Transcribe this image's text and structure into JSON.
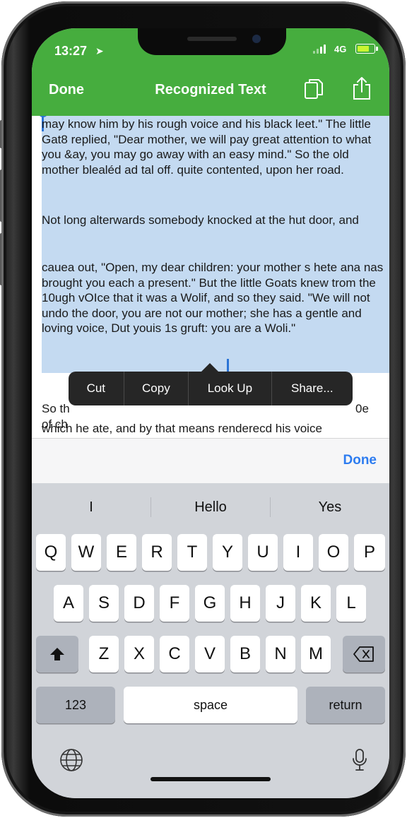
{
  "status": {
    "time": "13:27",
    "network": "4G"
  },
  "nav": {
    "done": "Done",
    "title": "Recognized Text"
  },
  "text": {
    "p1": "may know him by his rough voice and his black leet.\" The little Gat8 replied, \"Dear mother, we will pay great attention to what you &ay, you may go away with an easy mind.\" So the old mother blealéd ad tal off. quite contented, upon her road.",
    "p2": "Not long alterwards somebody knocked at the hut door, and",
    "p3": "cauea out, \"Open, my dear children: your mother s hete ana nas brought you each a present.\" But the little Goats knew trom the 10ugh vOIce that it was a Wolif, and so they said. \"We will not undo the door, you are not our mother; she has a gentle and loving voice, Dut youis 1s gruft: you are a Woli.\"",
    "p4_left": "So th",
    "p4_right": "0e",
    "p4_line2": "of ch",
    "p5": "which he ate, and by that means renderecd his voice"
  },
  "context_menu": [
    "Cut",
    "Copy",
    "Look Up",
    "Share..."
  ],
  "accessory": {
    "done": "Done"
  },
  "keyboard": {
    "suggestions": [
      "I",
      "Hello",
      "Yes"
    ],
    "row1": [
      "Q",
      "W",
      "E",
      "R",
      "T",
      "Y",
      "U",
      "I",
      "O",
      "P"
    ],
    "row2": [
      "A",
      "S",
      "D",
      "F",
      "G",
      "H",
      "J",
      "K",
      "L"
    ],
    "row3": [
      "Z",
      "X",
      "C",
      "V",
      "B",
      "N",
      "M"
    ],
    "numbers": "123",
    "space": "space",
    "return": "return"
  },
  "colors": {
    "header": "#46ad3e",
    "selection": "#c4daf1",
    "accent": "#2d7cf0"
  },
  "icons": [
    "location-arrow-icon",
    "signal-icon",
    "battery-icon",
    "copy-icon",
    "share-icon",
    "shift-icon",
    "backspace-icon",
    "globe-icon",
    "microphone-icon"
  ]
}
